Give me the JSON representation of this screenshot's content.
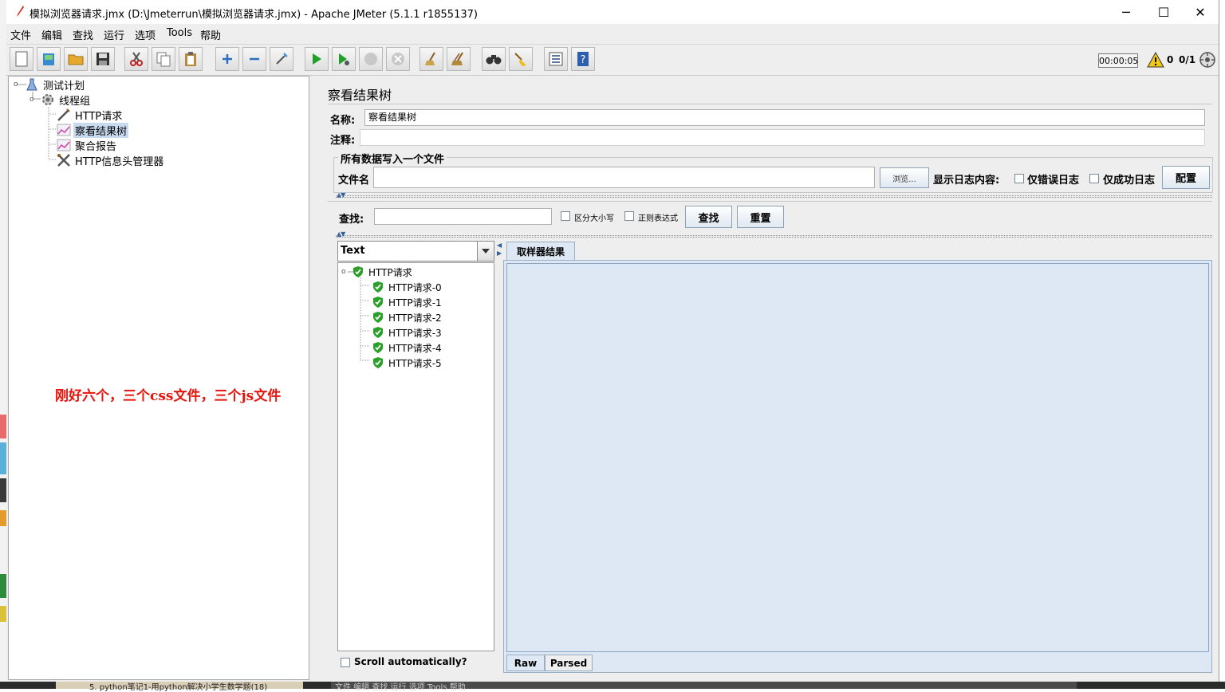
{
  "window": {
    "title": "模拟浏览器请求.jmx (D:\\Jmeterrun\\模拟浏览器请求.jmx) - Apache JMeter (5.1.1 r1855137)",
    "minimize": "─",
    "maximize": "☐",
    "close": "✕"
  },
  "menu": [
    "文件",
    "编辑",
    "查找",
    "运行",
    "选项",
    "Tools",
    "帮助"
  ],
  "status": {
    "timer": "00:00:05",
    "warnings": "0",
    "threads": "0/1"
  },
  "tree": {
    "nodes": [
      {
        "label": "测试计划",
        "icon": "test-plan-icon"
      },
      {
        "label": "线程组",
        "icon": "thread-group-icon"
      },
      {
        "label": "HTTP请求",
        "icon": "http-sampler-icon"
      },
      {
        "label": "察看结果树",
        "icon": "listener-chart-icon"
      },
      {
        "label": "聚合报告",
        "icon": "listener-chart-icon"
      },
      {
        "label": "HTTP信息头管理器",
        "icon": "tools-icon"
      }
    ],
    "annotation": "刚好六个，三个css文件，三个js文件"
  },
  "panel": {
    "title": "察看结果树",
    "name_label": "名称:",
    "name_value": "察看结果树",
    "comment_label": "注释:",
    "comment_value": "",
    "file_group_title": "所有数据写入一个文件",
    "filename_label": "文件名",
    "filename_value": "",
    "browse_button": "浏览...",
    "log_display_label": "显示日志内容:",
    "errors_only_label": "仅错误日志",
    "success_only_label": "仅成功日志",
    "config_button": "配置",
    "search_label": "查找:",
    "search_value": "",
    "case_sensitive_label": "区分大小写",
    "regex_label": "正则表达式",
    "find_button": "查找",
    "reset_button": "重置"
  },
  "results": {
    "renderer": "Text",
    "root": "HTTP请求",
    "children": [
      "HTTP请求-0",
      "HTTP请求-1",
      "HTTP请求-2",
      "HTTP请求-3",
      "HTTP请求-4",
      "HTTP请求-5"
    ],
    "scroll_automatically": "Scroll automatically?",
    "tab_label": "取样器结果",
    "raw_tab": "Raw",
    "parsed_tab": "Parsed"
  },
  "background": {
    "bottom_text_1": "5. python笔记1-用python解决小学生数学题(18)",
    "bottom_text_2": "文件   编辑   查找   运行   选项   Tools   帮助"
  },
  "colors": {
    "annotation": "#e8140c",
    "selection": "#c8daf0",
    "result_panel": "#dde8f4",
    "success_icon": "#2aa02a"
  }
}
